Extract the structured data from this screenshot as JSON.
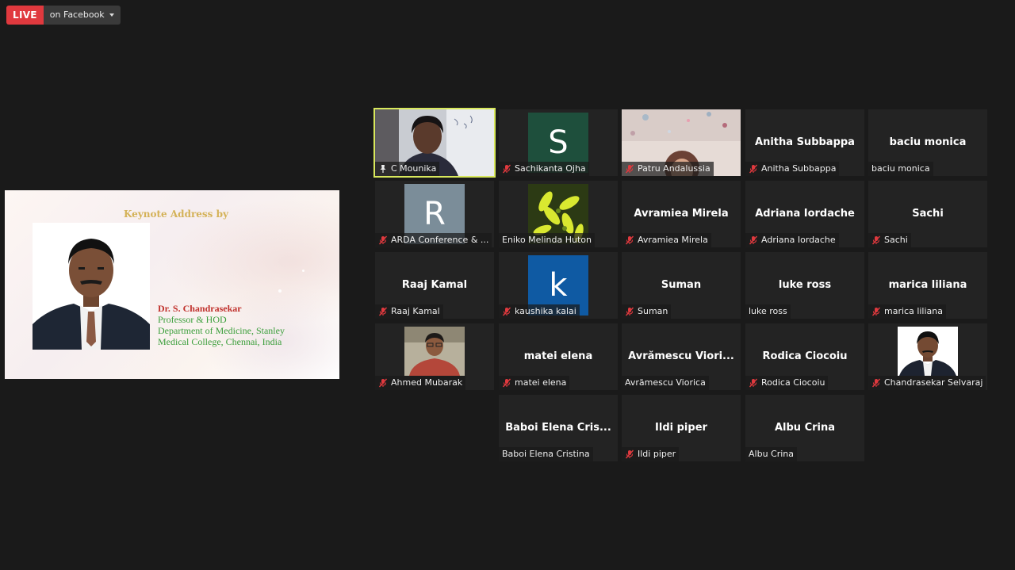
{
  "live": {
    "badge": "LIVE",
    "destination": "on Facebook"
  },
  "share": {
    "heading": "Keynote Address by",
    "speaker_name": "Dr. S. Chandrasekar",
    "lines": [
      "Professor & HOD",
      "Department of Medicine, Stanley",
      "Medical College, Chennai, India"
    ]
  },
  "colors": {
    "active_outline": "#d8e85c",
    "muted_icon": "#e0393e",
    "live_red": "#e0393e"
  },
  "participants": [
    {
      "name": "C Mounika",
      "video": true,
      "pinned": true,
      "active": true
    },
    {
      "name": "Sachikanta Ojha",
      "avatar": "S",
      "avatar_color": "#1e4f3c",
      "muted": true
    },
    {
      "name": "Patru Andalussia",
      "video": true,
      "muted": true
    },
    {
      "name": "Anitha Subbappa",
      "big": "Anitha Subbappa",
      "muted": true
    },
    {
      "name": "baciu monica",
      "big": "baciu monica"
    },
    {
      "name": "ARDA Conference & ...",
      "avatar": "R",
      "avatar_color": "#7b8d99",
      "muted": true
    },
    {
      "name": "Eniko Melinda Huton",
      "image": "flower-icon"
    },
    {
      "name": "Avramiea Mirela",
      "big": "Avramiea Mirela",
      "muted": true
    },
    {
      "name": "Adriana Iordache",
      "big": "Adriana Iordache",
      "muted": true
    },
    {
      "name": "Sachi",
      "big": "Sachi",
      "muted": true
    },
    {
      "name": "Raaj Kamal",
      "big": "Raaj Kamal",
      "muted": true
    },
    {
      "name": "kaushika kalai",
      "avatar": "k",
      "avatar_color": "#0f5aa3",
      "muted": true
    },
    {
      "name": "Suman",
      "big": "Suman",
      "muted": true
    },
    {
      "name": "luke ross",
      "big": "luke ross"
    },
    {
      "name": "marica liliana",
      "big": "marica liliana",
      "muted": true
    },
    {
      "name": "Ahmed Mubarak",
      "image": "person-photo",
      "muted": true
    },
    {
      "name": "matei elena",
      "big": "matei elena",
      "muted": true
    },
    {
      "name": "Avrămescu Viorica",
      "big": "Avrămescu  Viori..."
    },
    {
      "name": "Rodica Ciocoiu",
      "big": "Rodica Ciocoiu",
      "muted": true
    },
    {
      "name": "Chandrasekar Selvaraj",
      "image": "person-photo",
      "muted": true
    },
    {
      "name": "Baboi Elena Cristina",
      "big": "Baboi  Elena  Cris..."
    },
    {
      "name": "Ildi piper",
      "big": "Ildi piper",
      "muted": true
    },
    {
      "name": "Albu Crina",
      "big": "Albu Crina"
    }
  ]
}
